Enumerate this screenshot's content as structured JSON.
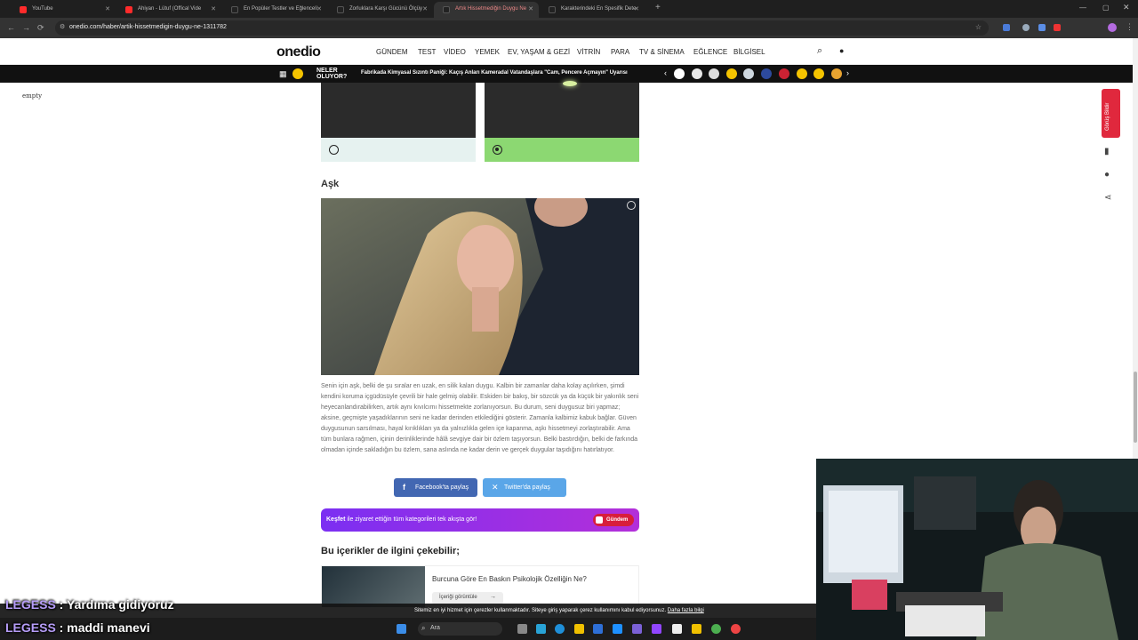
{
  "browser": {
    "tabs": [
      {
        "label": "YouTube",
        "color": "#ff2b2b"
      },
      {
        "label": "Ahiyan - Lütuf (Offical Vide",
        "color": "#ff2b2b"
      },
      {
        "label": "En Popüler Testler ve Eğlenceli",
        "color": "#222"
      },
      {
        "label": "Zorluklara Karşı Gücünü Ölçüy",
        "color": "#222"
      },
      {
        "label": "Artık Hissetmediğin Duygu Ne",
        "color": "#222"
      },
      {
        "label": "Karakterindeki En Spesifik Dete",
        "color": "#222"
      }
    ],
    "new_tab": "+",
    "url": "onedio.com/haber/artik-hissetmedigin-duygu-ne-1311782"
  },
  "site": {
    "logo": "onedio",
    "nav": [
      "GÜNDEM",
      "TEST",
      "VİDEO",
      "YEMEK",
      "EV, YAŞAM & GEZİ",
      "VİTRİN",
      "PARA",
      "TV & SİNEMA",
      "EĞLENCE",
      "BİLGİSEL"
    ],
    "ticker_label": "NELER OLUYOR?",
    "ticker_text": "Fabrikada Kimyasal Sızıntı Paniği: Kaçış Anları Kameradal Vatandaşlara \"Cam, Pencere Açmayın\" Uyarısı"
  },
  "left_text": "empty",
  "quiz": {
    "heading": "Aşk",
    "option_colors": [
      "#e6f2f0",
      "#8cd872"
    ],
    "selected_index": 1
  },
  "article": {
    "body": "Senin için aşk, belki de şu sıralar en uzak, en silik kalan duygu. Kalbin bir zamanlar daha kolay açılırken, şimdi kendini koruma içgüdüsüyle çevrili bir hale gelmiş olabilir. Eskiden bir bakış, bir sözcük ya da küçük bir yakınlık seni heyecanlandırabilirken, artık aynı kıvılcımı hissetmekte zorlanıyorsun. Bu durum, seni duygusuz biri yapmaz; aksine, geçmişte yaşadıklarının seni ne kadar derinden etkilediğini gösterir. Zamanla kalbimiz kabuk bağlar. Güven duygusunun sarsılması, hayal kırıklıkları ya da yalnızlıkla gelen içe kapanma, aşkı hissetmeyi zorlaştırabilir. Ama tüm bunlara rağmen, içinin derinliklerinde hâlâ sevgiye dair bir özlem taşıyorsun. Belki bastırdığın, belki de farkında olmadan içinde sakladığın bu özlem, sana aslında ne kadar derin ve gerçek duygular taşıdığını hatırlatıyor.",
    "share_facebook": "Facebook'ta paylaş",
    "share_twitter": "Twitter'da paylaş",
    "discover_bold": "Keşfet",
    "discover_text": " ile ziyaret ettiğin tüm kategorileri tek akışta gör!",
    "discover_button": "Gündem",
    "related_heading": "Bu içerikler de ilgini çekebilir;",
    "related_title": "Burcuna Göre En Baskın Psikolojik Özelliğin Ne?",
    "related_button": "İçeriği görüntüle"
  },
  "sidebar": {
    "follow_label": "Görüş Bildir"
  },
  "cookie": {
    "text": "Sitemiz en iyi hizmet için çerezler kullanmaktadır. Siteye giriş yaparak çerez kullanımını kabul ediyorsunuz.",
    "link": "Daha fazla bilgi"
  },
  "taskbar": {
    "search": "Ara"
  },
  "chat": [
    {
      "user": "LEGESS",
      "message": "Yardıma gidiyoruz"
    },
    {
      "user": "LEGESS",
      "message": "maddi manevi"
    }
  ]
}
